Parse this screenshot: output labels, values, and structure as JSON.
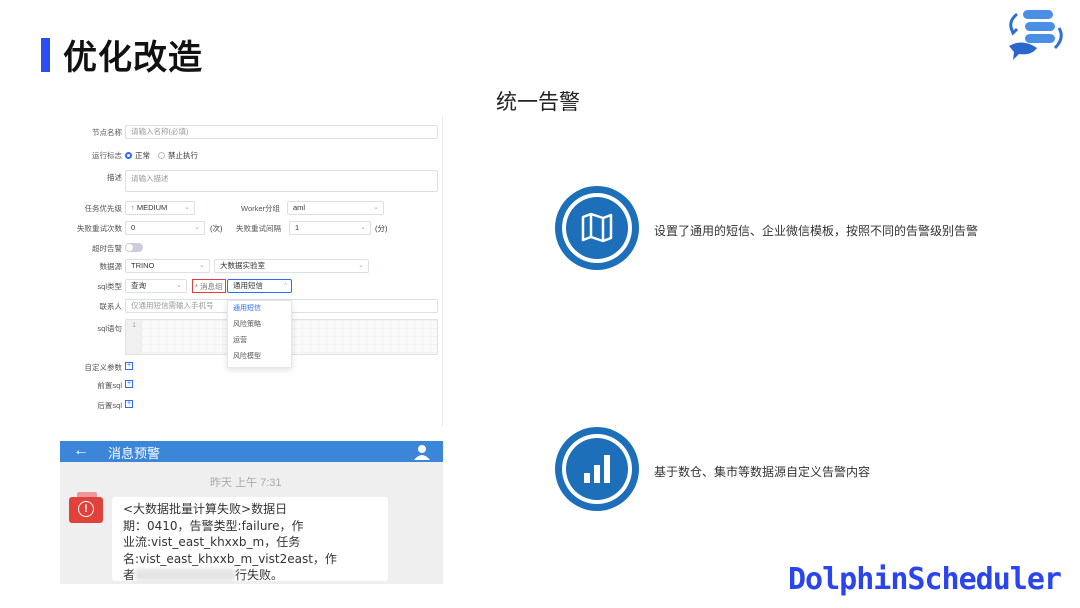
{
  "page_title": "优化改造",
  "section_title": "统一告警",
  "brand": "DolphinScheduler",
  "form": {
    "node_name_label": "节点名称",
    "node_name_placeholder": "请输入名称(必填)",
    "run_flag_label": "运行标志",
    "run_normal": "正常",
    "run_forbidden": "禁止执行",
    "desc_label": "描述",
    "desc_placeholder": "请输入描述",
    "priority_label": "任务优先级",
    "priority_value": "MEDIUM",
    "worker_group_label": "Worker分组",
    "worker_group_value": "aml",
    "retry_times_label": "失败重试次数",
    "retry_times_value": "0",
    "retry_times_unit": "(次)",
    "retry_interval_label": "失败重试间隔",
    "retry_interval_value": "1",
    "retry_interval_unit": "(分)",
    "timeout_label": "超时告警",
    "datasource_label": "数据源",
    "datasource_type": "TRINO",
    "datasource_name": "大数据实验室",
    "sql_type_label": "sql类型",
    "sql_type_value": "查询",
    "message_group_label": "* 消息组",
    "message_group_value": "通用短信",
    "contact_label": "联系人",
    "contact_placeholder": "仅通用短信需输入手机号",
    "sql_label": "sql语句",
    "sql_line_number": "1",
    "custom_params_label": "自定义参数",
    "pre_sql_label": "前置sql",
    "post_sql_label": "后置sql",
    "dropdown_options": [
      "通用短信",
      "风险策略",
      "运营",
      "风险模型"
    ]
  },
  "message": {
    "header_title": "消息预警",
    "time": "昨天  上午 7:31",
    "lines": [
      "<大数据批量计算失败>数据日",
      "期：0410，告警类型:failure，作",
      "业流:vist_east_khxxb_m，任务",
      "名:vist_east_khxxb_m_vist2east，作"
    ],
    "last_line_start": "者",
    "last_line_end": "行失败。"
  },
  "features": [
    {
      "text": "设置了通用的短信、企业微信模板，按照不同的告警级别告警",
      "icon": "map-icon"
    },
    {
      "text": "基于数仓、集市等数据源自定义告警内容",
      "icon": "bar-chart-icon"
    }
  ],
  "colors": {
    "accent_blue": "#2d4ef5",
    "brand_blue": "#2b45ee",
    "circle_blue": "#1c6fb8",
    "alert_red": "#e0413a"
  }
}
